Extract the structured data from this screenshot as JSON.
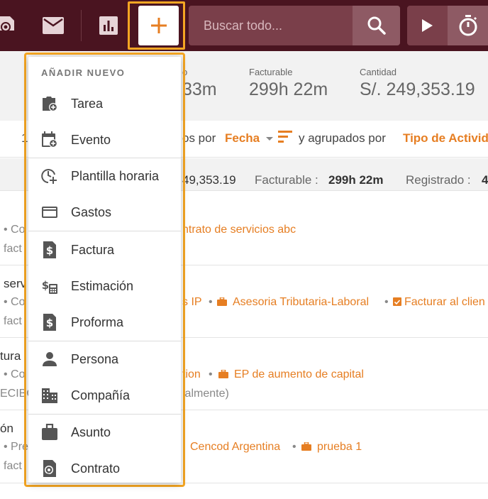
{
  "search": {
    "placeholder": "Buscar todo..."
  },
  "stats": {
    "partial_value": "33m",
    "partial_label_tail": "o",
    "billable_label": "Facturable",
    "billable_value": "299h 22m",
    "amount_label": "Cantidad",
    "amount_value": "S/. 249,353.19"
  },
  "sortbar": {
    "prefix": "1",
    "text1": "os por",
    "sort_field": "Fecha",
    "text2": "y agrupados por",
    "group_field": "Tipo de Activid"
  },
  "totals": {
    "amount_value": "49,353.19",
    "billable_label": "Facturable :",
    "billable_value": "299h 22m",
    "registered_label": "Registrado :",
    "registered_value": "4"
  },
  "rows": [
    {
      "title": "",
      "meta1": "• Co",
      "link1": "ntrato de servicios abc",
      "meta2": "fact"
    },
    {
      "title": "serv",
      "meta1": "• Co",
      "link1": "s IP",
      "link2": "Asesoria Tributaria-Laboral",
      "link3": "Facturar al clien",
      "meta2": "fact"
    },
    {
      "title": "tura",
      "meta1": "• Co",
      "link1": "tion",
      "link2": "EP de aumento de capital",
      "meta2": "ECIBO",
      "meta3": "ialmente)"
    },
    {
      "title": "ón",
      "meta1": "• Pre",
      "link1": "Cencod Argentina",
      "link2": "prueba 1",
      "meta2": "fact"
    }
  ],
  "menu": {
    "header": "AÑADIR NUEVO",
    "items": [
      {
        "label": "Tarea",
        "icon": "task-add-icon"
      },
      {
        "label": "Evento",
        "icon": "event-add-icon"
      },
      {
        "label": "Plantilla horaria",
        "icon": "time-template-add-icon"
      },
      {
        "label": "Gastos",
        "icon": "credit-card-icon"
      },
      {
        "label": "Factura",
        "icon": "invoice-icon"
      },
      {
        "label": "Estimación",
        "icon": "estimate-icon"
      },
      {
        "label": "Proforma",
        "icon": "proforma-icon"
      },
      {
        "label": "Persona",
        "icon": "person-icon"
      },
      {
        "label": "Compañía",
        "icon": "company-icon"
      },
      {
        "label": "Asunto",
        "icon": "briefcase-icon"
      },
      {
        "label": "Contrato",
        "icon": "contract-icon"
      }
    ]
  },
  "colors": {
    "topbar": "#4a1420",
    "accent": "#e67e22",
    "highlight": "#f5a623"
  }
}
